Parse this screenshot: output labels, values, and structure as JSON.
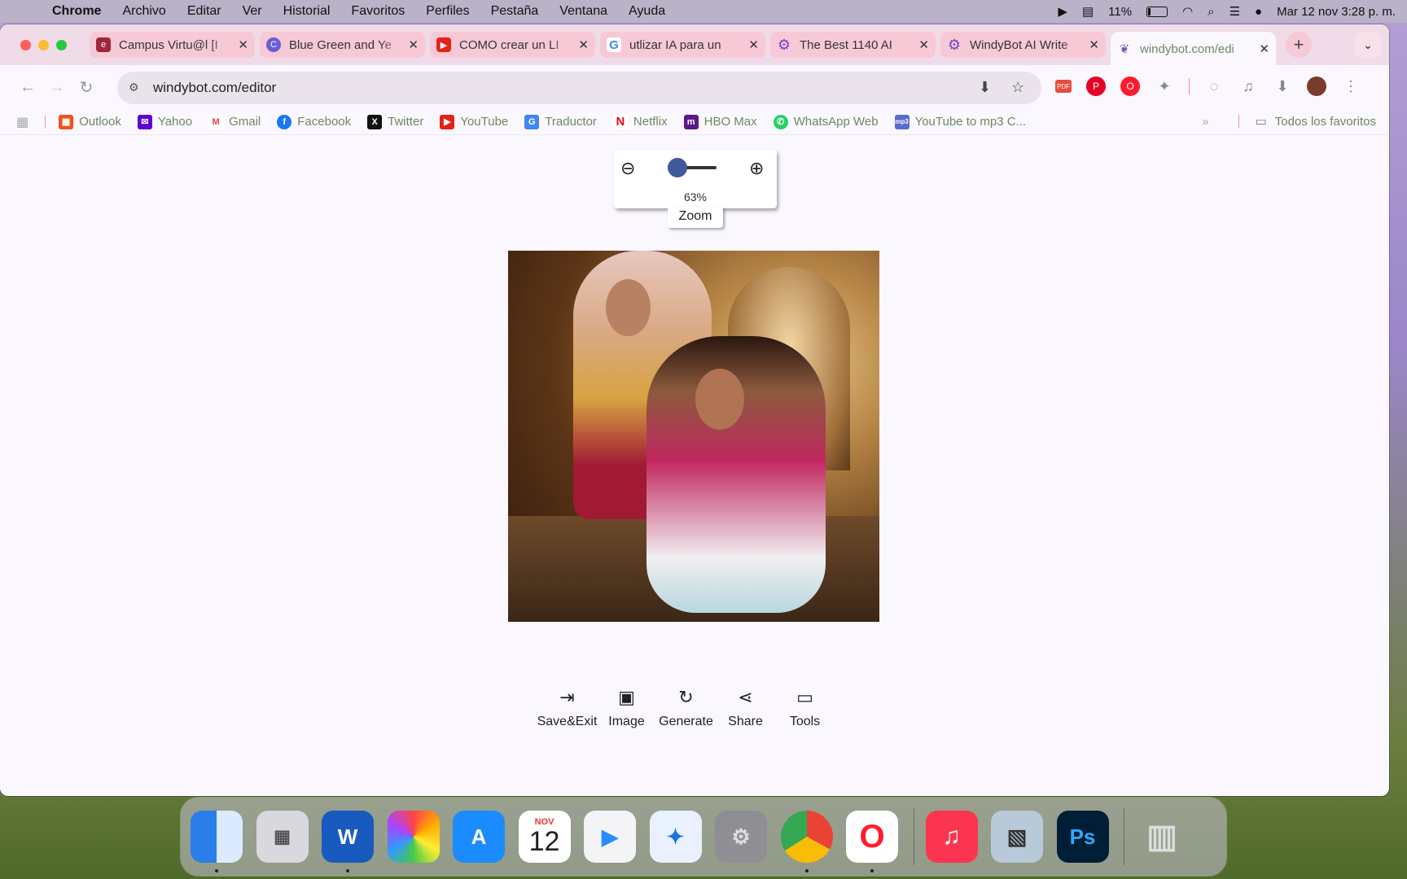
{
  "menubar": {
    "app": "Chrome",
    "items": [
      "Archivo",
      "Editar",
      "Ver",
      "Historial",
      "Favoritos",
      "Perfiles",
      "Pestaña",
      "Ventana",
      "Ayuda"
    ],
    "battery": "11%",
    "datetime": "Mar 12 nov  3:28 p. m."
  },
  "tabs": [
    {
      "title": "Campus Virtu@l [I",
      "icon": "campus-icon",
      "color": "#a1263b"
    },
    {
      "title": "Blue Green and Ye",
      "icon": "canva-icon",
      "color": "#6a5cd8"
    },
    {
      "title": "COMO crear un LI",
      "icon": "youtube-icon",
      "color": "#e62117"
    },
    {
      "title": "utlizar IA para un",
      "icon": "google-icon",
      "color": "#4285f4"
    },
    {
      "title": "The Best 1140 AI",
      "icon": "gear-icon",
      "color": "#6f3fd0"
    },
    {
      "title": "WindyBot AI Write",
      "icon": "gear-icon",
      "color": "#6f3fd0"
    },
    {
      "title": "windybot.com/edi",
      "icon": "windybot-icon",
      "color": "#7a5cb8"
    }
  ],
  "address": {
    "url": "windybot.com/editor"
  },
  "bookmarks": [
    {
      "label": "Outlook",
      "color": "#f25022",
      "icon": "microsoft-icon"
    },
    {
      "label": "Yahoo",
      "color": "#5f01d1",
      "icon": "mail-icon"
    },
    {
      "label": "Gmail",
      "color": "#ea4335",
      "icon": "gmail-icon"
    },
    {
      "label": "Facebook",
      "color": "#1877f2",
      "icon": "facebook-icon"
    },
    {
      "label": "Twitter",
      "color": "#111111",
      "icon": "x-icon"
    },
    {
      "label": "YouTube",
      "color": "#e62117",
      "icon": "youtube-icon"
    },
    {
      "label": "Traductor",
      "color": "#4285f4",
      "icon": "translate-icon"
    },
    {
      "label": "Netflix",
      "color": "#e50914",
      "icon": "netflix-icon"
    },
    {
      "label": "HBO Max",
      "color": "#5b1a86",
      "icon": "hbo-icon"
    },
    {
      "label": "WhatsApp Web",
      "color": "#25d366",
      "icon": "whatsapp-icon"
    },
    {
      "label": "YouTube to mp3 C...",
      "color": "#5a6ad1",
      "icon": "mp3-icon"
    }
  ],
  "bookmarks_all": "Todos los favoritos",
  "zoom": {
    "percent": "63%",
    "label": "Zoom",
    "level": 0.63
  },
  "toolbar": {
    "save_exit": "Save&Exit",
    "image": "Image",
    "generate": "Generate",
    "share": "Share",
    "tools": "Tools"
  },
  "dock": {
    "calendar_month": "NOV",
    "calendar_day": "12",
    "word": "W",
    "photoshop": "Ps"
  }
}
